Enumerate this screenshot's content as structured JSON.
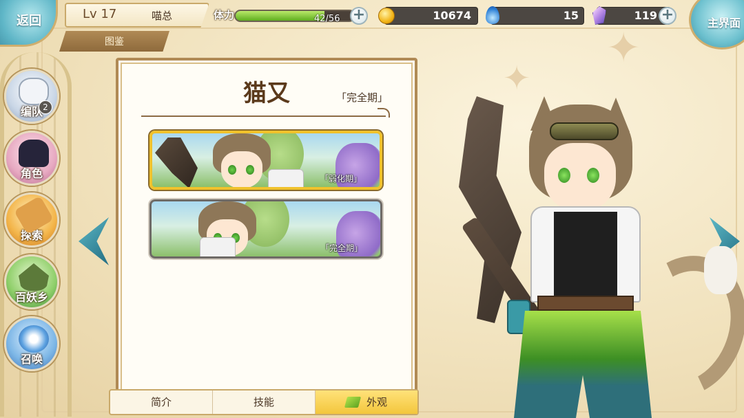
{
  "top_bar": {
    "back_label": "返回",
    "level": "Lv 17",
    "player_name": "喵总",
    "section_label": "图鉴",
    "stamina": {
      "label": "体力",
      "text": "42/56",
      "fraction": 0.75
    },
    "gold": "10674",
    "blue_flame": "15",
    "crystal": "119",
    "home_label": "主界面"
  },
  "sidebar": {
    "items": [
      {
        "label": "编队",
        "badge": "2"
      },
      {
        "label": "角色"
      },
      {
        "label": "探索"
      },
      {
        "label": "百妖乡"
      },
      {
        "label": "召唤"
      }
    ]
  },
  "panel": {
    "title": "猫又",
    "current_stage": "「完全期」",
    "forms": [
      {
        "stage": "「弱化期」",
        "selected": true
      },
      {
        "stage": "「完全期」",
        "selected": false
      }
    ],
    "tabs": [
      {
        "label": "简介",
        "active": false
      },
      {
        "label": "技能",
        "active": false
      },
      {
        "label": "外观",
        "active": true
      }
    ]
  },
  "icons": {
    "gold": "coin-icon",
    "blue_flame": "flame-icon",
    "crystal": "crystal-icon",
    "plus": "plus-icon",
    "prev": "arrow-left-icon",
    "next": "arrow-right-icon",
    "appearance_tab": "leaf-icon"
  },
  "colors": {
    "accent_teal": "#5db9c7",
    "selected_border": "#f0c22c",
    "stamina_fill": "#7cc534",
    "panel_border": "#b08a55"
  }
}
